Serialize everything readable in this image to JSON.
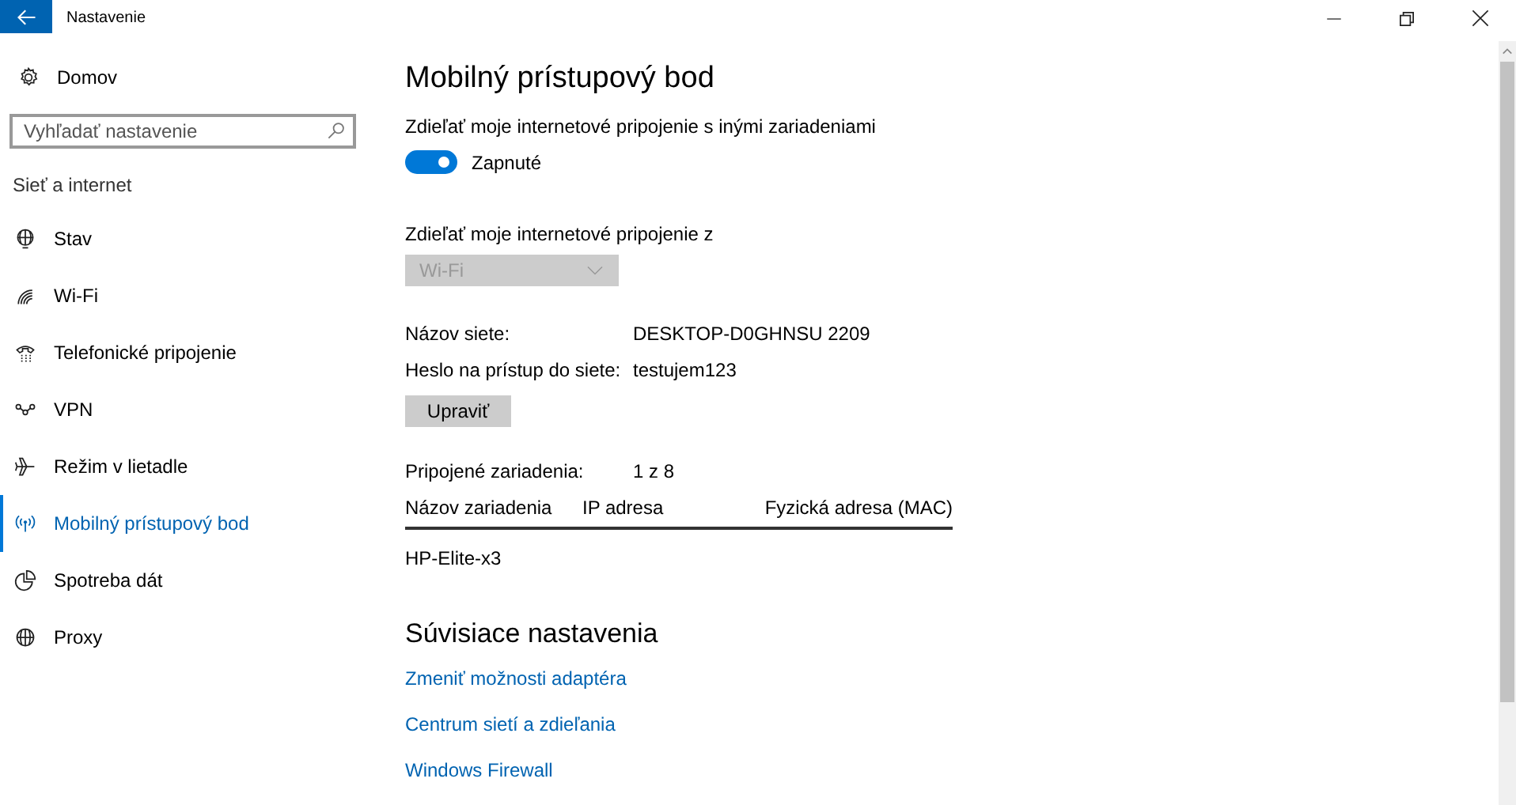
{
  "window": {
    "title": "Nastavenie"
  },
  "sidebar": {
    "home": "Domov",
    "search": {
      "placeholder": "Vyhľadať nastavenie"
    },
    "section": "Sieť a internet",
    "items": [
      {
        "label": "Stav",
        "selected": false
      },
      {
        "label": "Wi-Fi",
        "selected": false
      },
      {
        "label": "Telefonické pripojenie",
        "selected": false
      },
      {
        "label": "VPN",
        "selected": false
      },
      {
        "label": "Režim v lietadle",
        "selected": false
      },
      {
        "label": "Mobilný prístupový bod",
        "selected": true
      },
      {
        "label": "Spotreba dát",
        "selected": false
      },
      {
        "label": "Proxy",
        "selected": false
      }
    ]
  },
  "main": {
    "title": "Mobilný prístupový bod",
    "share_label": "Zdieľať moje internetové pripojenie s inými zariadeniami",
    "toggle": {
      "on": true,
      "label": "Zapnuté"
    },
    "source_label": "Zdieľať moje internetové pripojenie z",
    "source_dropdown": {
      "value": "Wi-Fi",
      "disabled": true
    },
    "info": [
      {
        "label": "Názov siete:",
        "value": "DESKTOP-D0GHNSU 2209"
      },
      {
        "label": "Heslo na prístup do siete:",
        "value": "testujem123"
      }
    ],
    "edit_button": "Upraviť",
    "connected": {
      "label": "Pripojené zariadenia:",
      "value": "1 z 8"
    },
    "table": {
      "columns": [
        "Názov zariadenia",
        "IP adresa",
        "Fyzická adresa (MAC)"
      ],
      "rows": [
        [
          "HP-Elite-x3",
          "",
          ""
        ]
      ]
    },
    "related_title": "Súvisiace nastavenia",
    "links": [
      "Zmeniť možnosti adaptéra",
      "Centrum sietí a zdieľania",
      "Windows Firewall"
    ]
  }
}
